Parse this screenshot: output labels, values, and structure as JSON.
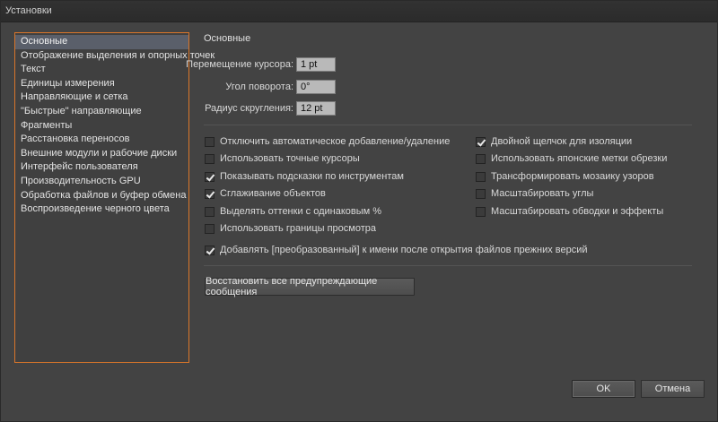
{
  "window": {
    "title": "Установки"
  },
  "sidebar": {
    "items": [
      {
        "label": "Основные",
        "active": true
      },
      {
        "label": "Отображение выделения и опорных точек"
      },
      {
        "label": "Текст"
      },
      {
        "label": "Единицы измерения"
      },
      {
        "label": "Направляющие и сетка"
      },
      {
        "label": "\"Быстрые\" направляющие"
      },
      {
        "label": "Фрагменты"
      },
      {
        "label": "Расстановка переносов"
      },
      {
        "label": "Внешние модули и рабочие диски"
      },
      {
        "label": "Интерфейс пользователя"
      },
      {
        "label": "Производительность GPU"
      },
      {
        "label": "Обработка файлов и буфер обмена"
      },
      {
        "label": "Воспроизведение черного цвета"
      }
    ]
  },
  "main": {
    "section_title": "Основные",
    "fields": {
      "cursor_move": {
        "label": "Перемещение курсора:",
        "value": "1 pt"
      },
      "rotation": {
        "label": "Угол поворота:",
        "value": "0°"
      },
      "corner_radius": {
        "label": "Радиус скругления:",
        "value": "12 pt"
      }
    },
    "checkboxes_left": [
      {
        "label": "Отключить автоматическое добавление/удаление",
        "checked": false
      },
      {
        "label": "Использовать точные курсоры",
        "checked": false
      },
      {
        "label": "Показывать подсказки по инструментам",
        "checked": true
      },
      {
        "label": "Сглаживание объектов",
        "checked": true
      },
      {
        "label": "Выделять оттенки с одинаковым %",
        "checked": false
      },
      {
        "label": "Использовать границы просмотра",
        "checked": false
      }
    ],
    "checkboxes_right": [
      {
        "label": "Двойной щелчок для изоляции",
        "checked": true
      },
      {
        "label": "Использовать японские метки обрезки",
        "checked": false
      },
      {
        "label": "Трансформировать мозаику узоров",
        "checked": false
      },
      {
        "label": "Масштабировать углы",
        "checked": false
      },
      {
        "label": "Масштабировать обводки и эффекты",
        "checked": false
      }
    ],
    "append_checkbox": {
      "label": "Добавлять [преобразованный] к имени после открытия файлов прежних версий",
      "checked": true
    },
    "reset_warnings_label": "Восстановить все предупреждающие сообщения"
  },
  "footer": {
    "ok_label": "OK",
    "cancel_label": "Отмена"
  }
}
